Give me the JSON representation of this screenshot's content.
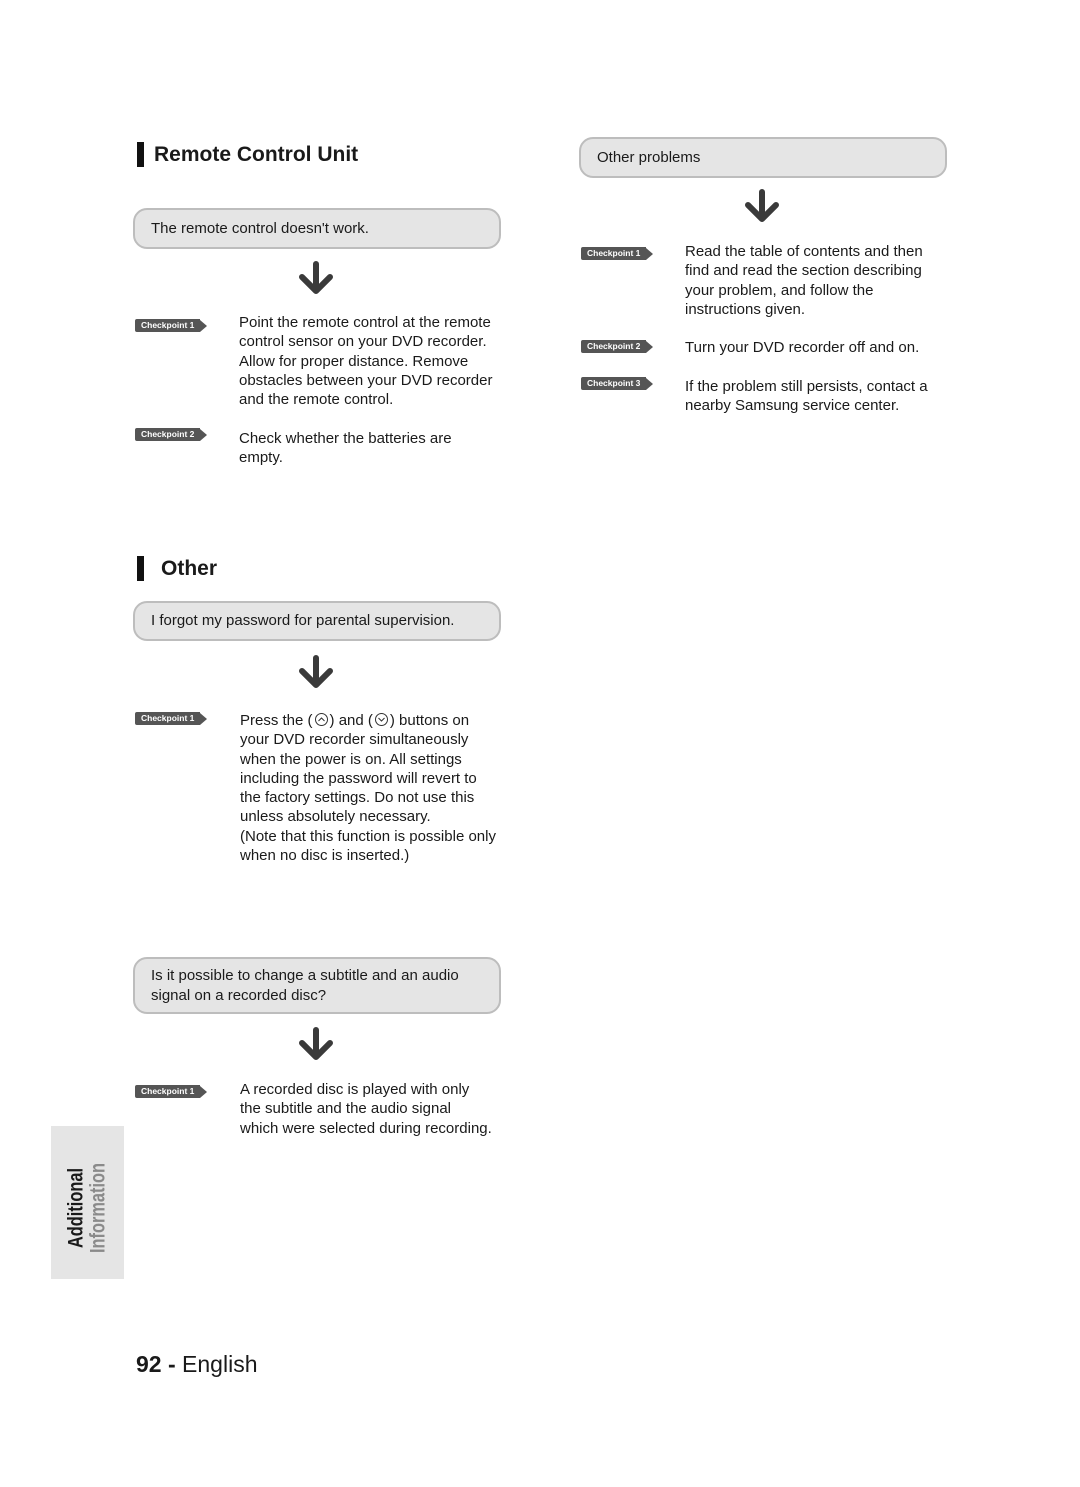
{
  "left": {
    "remote_section": {
      "title": "Remote Control Unit",
      "question": "The remote control doesn't work.",
      "checkpoints": [
        {
          "label": "Checkpoint 1",
          "lines": [
            "Point the remote control at the remote",
            "control sensor on your DVD recorder.",
            "Allow for proper distance. Remove",
            "obstacles between your DVD recorder",
            "and the remote control."
          ]
        },
        {
          "label": "Checkpoint 2",
          "lines": [
            "Check whether the batteries are",
            "empty."
          ]
        }
      ]
    },
    "other_section": {
      "title": "Other",
      "question": "I forgot my password for parental supervision.",
      "checkpoints": [
        {
          "label": "Checkpoint 1",
          "first_line": {
            "before": "Press the (",
            "middle": ") and (",
            "after": ") buttons on"
          },
          "icons": [
            "up-button-icon",
            "down-button-icon"
          ],
          "lines": [
            "your DVD recorder simultaneously",
            "when the power is on. All settings",
            "including the password will revert to",
            "the factory settings. Do not use this",
            "unless absolutely necessary.",
            "(Note that this function is possible only",
            "when no disc is inserted.)"
          ]
        }
      ]
    },
    "subtitle_section": {
      "question_lines": [
        "Is it possible to change a subtitle and an audio",
        "signal on a recorded disc?"
      ],
      "checkpoints": [
        {
          "label": "Checkpoint 1",
          "lines": [
            "A recorded disc is played with only",
            "the subtitle and the audio signal",
            "which were selected during recording."
          ]
        }
      ]
    }
  },
  "right": {
    "other_problems": {
      "question": "Other problems",
      "checkpoints": [
        {
          "label": "Checkpoint 1",
          "lines": [
            "Read the table of contents and then",
            "find and read the section describing",
            "your problem, and follow the",
            "instructions given."
          ]
        },
        {
          "label": "Checkpoint 2",
          "lines": [
            "Turn your DVD recorder off and on."
          ]
        },
        {
          "label": "Checkpoint 3",
          "lines": [
            "If the problem still persists, contact a",
            "nearby Samsung service center."
          ]
        }
      ]
    }
  },
  "side_tab": {
    "line1": "Additional",
    "line2": "Information"
  },
  "footer": {
    "page_number": "92",
    "separator": " - ",
    "language": "English"
  },
  "colors": {
    "box_fill": "#e5e5e5",
    "box_border": "#bdbdbd",
    "badge": "#555555",
    "arrow": "#3a3a3a"
  }
}
